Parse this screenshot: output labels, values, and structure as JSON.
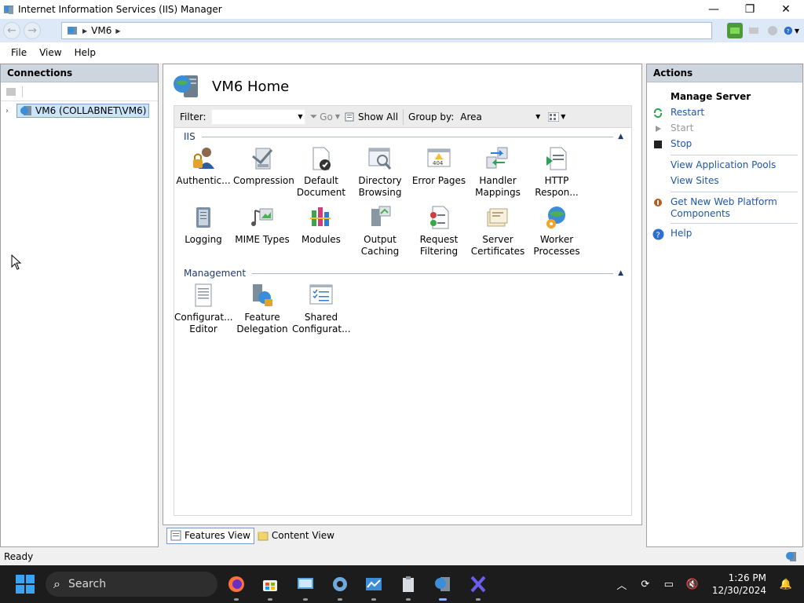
{
  "window": {
    "title": "Internet Information Services (IIS) Manager",
    "minimize": "—",
    "restore": "❐",
    "close": "✕"
  },
  "address": {
    "path": [
      "VM6"
    ]
  },
  "menu": [
    "File",
    "View",
    "Help"
  ],
  "connections": {
    "title": "Connections",
    "tree_node": "VM6 (COLLABNET\\VM6)"
  },
  "main": {
    "title": "VM6 Home",
    "filter_label": "Filter:",
    "go_label": "Go",
    "show_all_label": "Show All",
    "group_by_label": "Group by:",
    "group_by_value": "Area",
    "groups": [
      {
        "name": "IIS",
        "features": [
          {
            "label": "Authentic...",
            "icon": "authentication-icon"
          },
          {
            "label": "Compression",
            "icon": "compression-icon"
          },
          {
            "label": "Default Document",
            "icon": "default-document-icon"
          },
          {
            "label": "Directory Browsing",
            "icon": "directory-browsing-icon"
          },
          {
            "label": "Error Pages",
            "icon": "error-pages-icon"
          },
          {
            "label": "Handler Mappings",
            "icon": "handler-mappings-icon"
          },
          {
            "label": "HTTP Respon...",
            "icon": "http-response-icon"
          },
          {
            "label": "Logging",
            "icon": "logging-icon"
          },
          {
            "label": "MIME Types",
            "icon": "mime-types-icon"
          },
          {
            "label": "Modules",
            "icon": "modules-icon"
          },
          {
            "label": "Output Caching",
            "icon": "output-caching-icon"
          },
          {
            "label": "Request Filtering",
            "icon": "request-filtering-icon"
          },
          {
            "label": "Server Certificates",
            "icon": "server-certificates-icon"
          },
          {
            "label": "Worker Processes",
            "icon": "worker-processes-icon"
          }
        ]
      },
      {
        "name": "Management",
        "features": [
          {
            "label": "Configurat... Editor",
            "icon": "configuration-editor-icon"
          },
          {
            "label": "Feature Delegation",
            "icon": "feature-delegation-icon"
          },
          {
            "label": "Shared Configurat...",
            "icon": "shared-configuration-icon"
          }
        ]
      }
    ],
    "tabs": {
      "features_view": "Features View",
      "content_view": "Content View"
    }
  },
  "actions": {
    "title": "Actions",
    "section": "Manage Server",
    "restart": "Restart",
    "start": "Start",
    "stop": "Stop",
    "view_app_pools": "View Application Pools",
    "view_sites": "View Sites",
    "get_web_platform": "Get New Web Platform Components",
    "help": "Help"
  },
  "status": {
    "text": "Ready"
  },
  "taskbar": {
    "search_placeholder": "Search",
    "time": "1:26 PM",
    "date": "12/30/2024"
  },
  "colors": {
    "accent": "#1f56a8",
    "group_header": "#1f3b6e",
    "panel_header": "#cdd5de",
    "address_bg": "#dde9f7",
    "taskbar_bg": "#1c1c1c"
  }
}
